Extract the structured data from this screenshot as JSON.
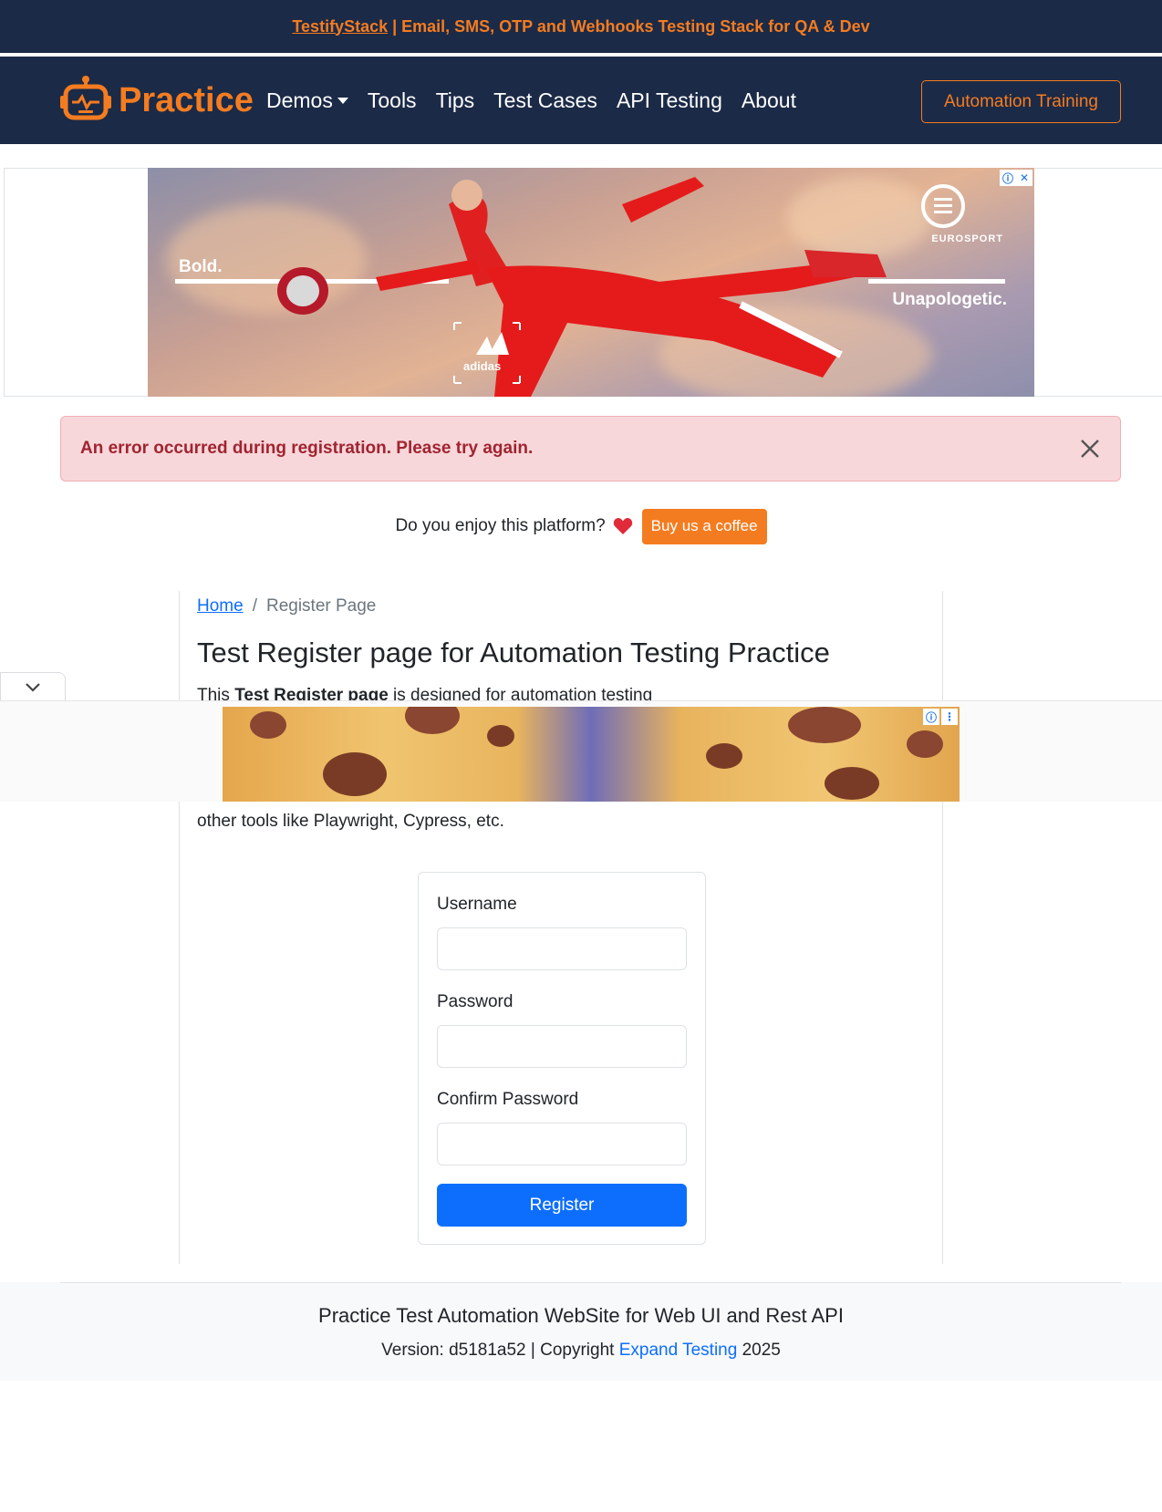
{
  "topbar": {
    "link_text": "TestifyStack",
    "rest_text": " | Email, SMS, OTP and Webhooks Testing Stack for QA & Dev"
  },
  "navbar": {
    "brand": "Practice",
    "items": [
      {
        "label": "Demos",
        "has_dropdown": true
      },
      {
        "label": "Tools"
      },
      {
        "label": "Tips"
      },
      {
        "label": "Test Cases"
      },
      {
        "label": "API Testing"
      },
      {
        "label": "About"
      }
    ],
    "cta": "Automation Training"
  },
  "ad_top": {
    "text_left": "Bold.",
    "text_right": "Unapologetic.",
    "sponsor": "EUROSPORT",
    "brand_mark": "adidas"
  },
  "alert": {
    "message": "An error occurred during registration. Please try again."
  },
  "coffee": {
    "question": "Do you enjoy this platform?",
    "button": "Buy us a coffee"
  },
  "breadcrumb": {
    "home": "Home",
    "separator": "/",
    "current": "Register Page"
  },
  "page": {
    "title": "Test Register page for Automation Testing Practice",
    "intro_prefix": "This ",
    "intro_bold": "Test Register page",
    "intro_suffix": " is designed for automation testing",
    "intro_line2": "other tools like Playwright, Cypress, etc."
  },
  "form": {
    "username_label": "Username",
    "password_label": "Password",
    "confirm_label": "Confirm Password",
    "username_value": "",
    "password_value": "",
    "confirm_value": "",
    "submit": "Register"
  },
  "footer": {
    "title": "Practice Test Automation WebSite for Web UI and Rest API",
    "version_text": "Version: d5181a52 | Copyright ",
    "link": "Expand Testing",
    "year": " 2025"
  },
  "colors": {
    "navy": "#1b2a47",
    "orange": "#f47c20",
    "primary": "#0d6efd",
    "alert_bg": "#f8d7da",
    "alert_text": "#a02431"
  }
}
